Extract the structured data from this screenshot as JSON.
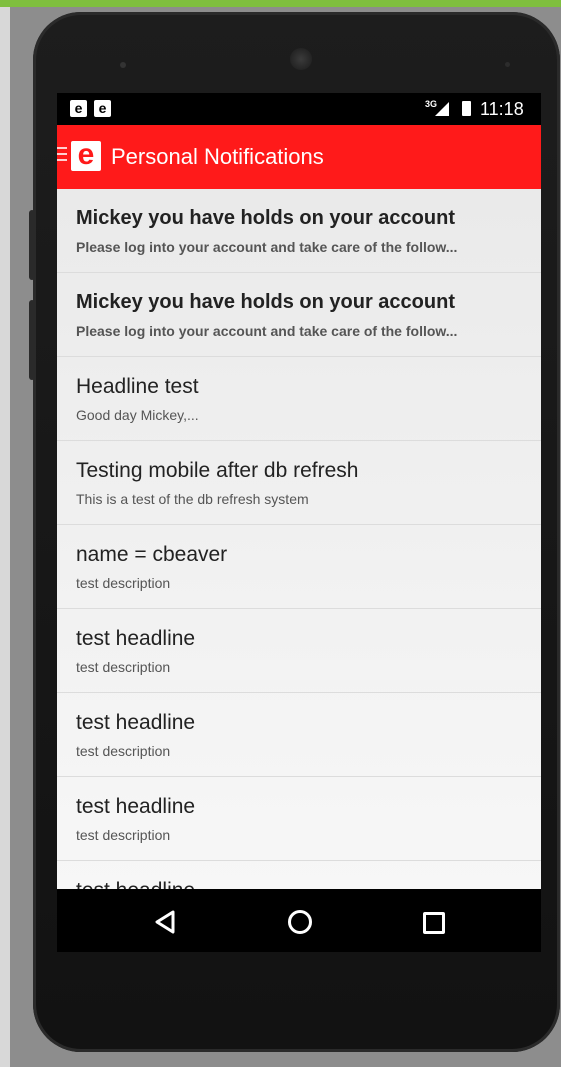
{
  "status_bar": {
    "notif_icons": [
      "e",
      "e"
    ],
    "network": "3G",
    "time": "11:18"
  },
  "app_bar": {
    "logo_letter": "e",
    "title": "Personal Notifications"
  },
  "notifications": [
    {
      "headline": "Mickey you have holds on your account",
      "description": "Please log into your account and take care of the follow...",
      "unread": true
    },
    {
      "headline": "Mickey you have holds on your account",
      "description": "Please log into your account and take care of the follow...",
      "unread": true
    },
    {
      "headline": "Headline test",
      "description": "Good day Mickey,...",
      "unread": false
    },
    {
      "headline": "Testing mobile after db refresh",
      "description": "This is a test of the db refresh system",
      "unread": false
    },
    {
      "headline": "name = cbeaver",
      "description": "test description",
      "unread": false
    },
    {
      "headline": "test headline",
      "description": "test description",
      "unread": false
    },
    {
      "headline": "test headline",
      "description": "test description",
      "unread": false
    },
    {
      "headline": "test headline",
      "description": "test description",
      "unread": false
    },
    {
      "headline": "test headline",
      "description": "",
      "unread": false
    }
  ],
  "nav_bar": {
    "icons": [
      "back-icon",
      "home-icon",
      "recents-icon"
    ]
  },
  "colors": {
    "app_bar": "#ff1a1a",
    "list_bg": "#f2f2f2"
  }
}
